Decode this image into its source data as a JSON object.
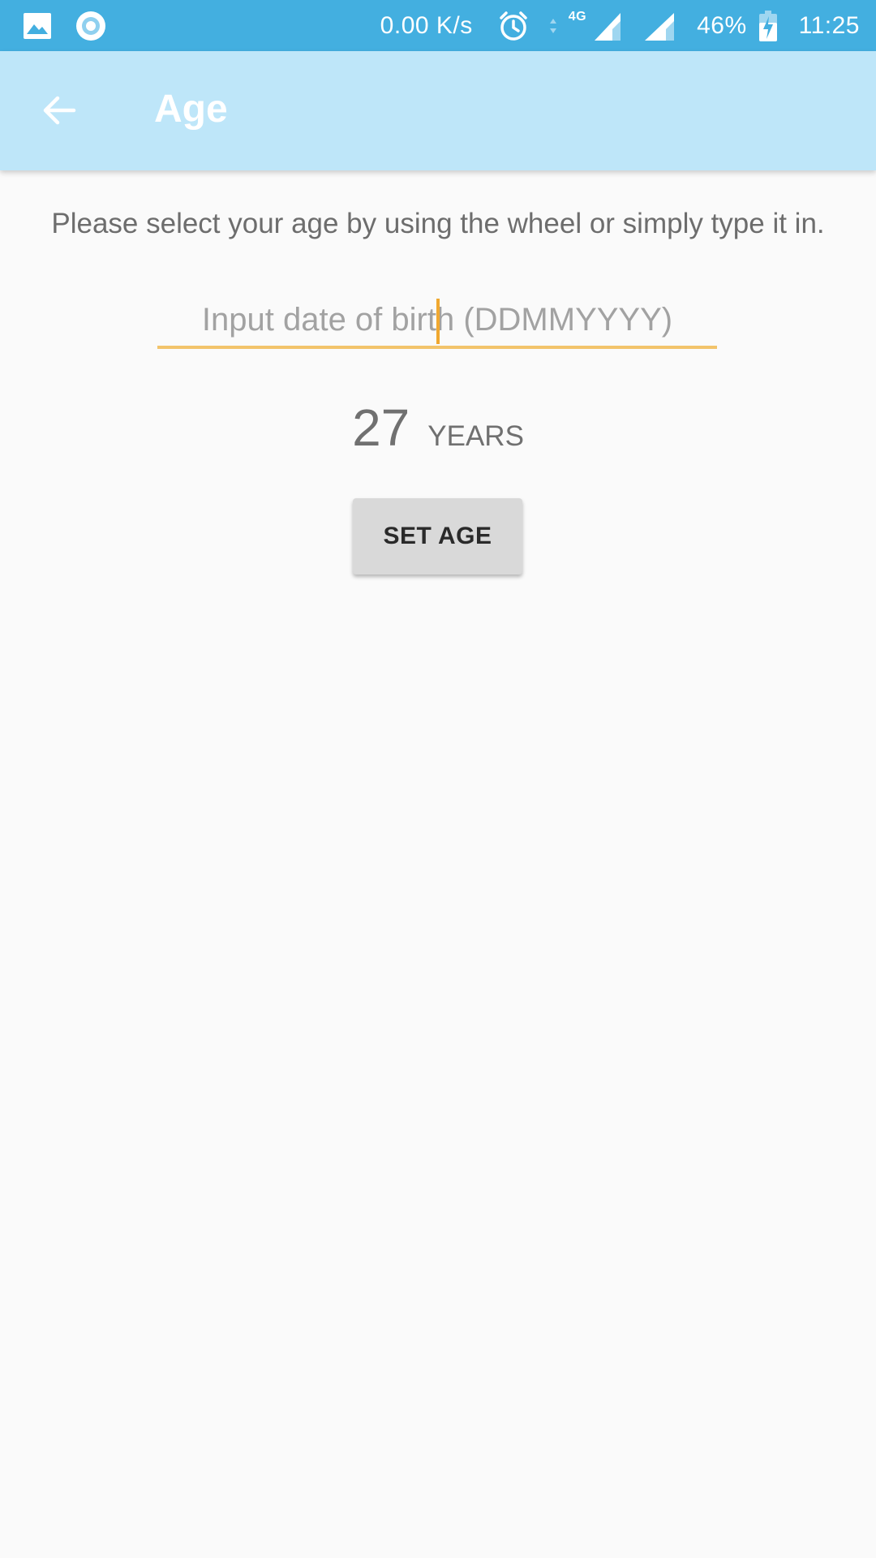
{
  "status_bar": {
    "network_speed": "0.00 K/s",
    "network_type": "4G",
    "battery": "46%",
    "time": "11:25",
    "icons": [
      "image-icon",
      "circle-app-icon",
      "alarm-icon",
      "data-arrows-icon",
      "signal-4g-icon",
      "signal-icon",
      "battery-charging-icon"
    ]
  },
  "app_bar": {
    "title": "Age",
    "back_icon": "arrow-left-icon"
  },
  "content": {
    "instructions": "Please select your age by using the wheel or simply type it in.",
    "dob_input": {
      "placeholder": "Input date of birth (DDMMYYYY)",
      "value": ""
    },
    "age_value": "27",
    "age_unit": "YEARS",
    "set_age_label": "SET AGE"
  },
  "colors": {
    "status_bar": "#43afe0",
    "app_bar": "#bee6f9",
    "input_underline": "#f2c46b",
    "background": "#fafafa",
    "button": "#d9d9d9"
  }
}
